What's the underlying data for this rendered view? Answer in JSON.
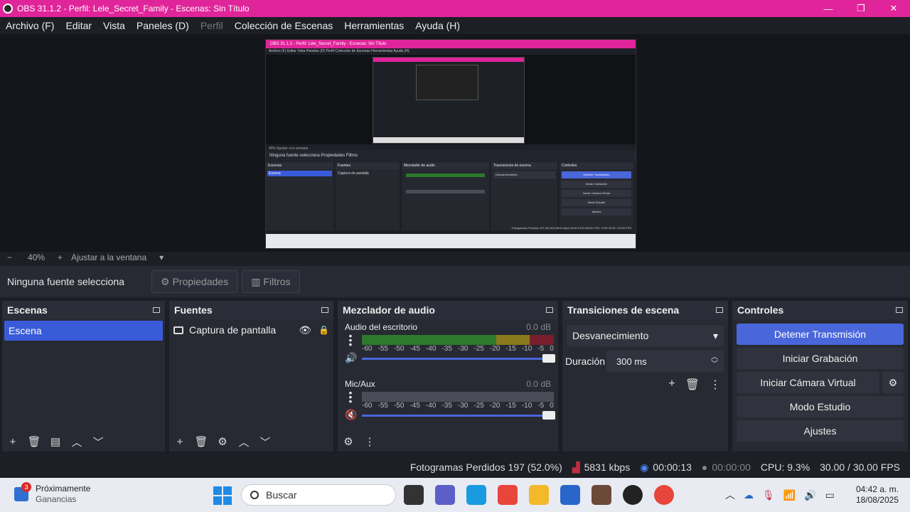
{
  "window": {
    "title": "OBS 31.1.2 - Perfil: Lele_Secret_Family - Escenas: Sin Título",
    "minimize": "—",
    "maximize": "❐",
    "close": "✕"
  },
  "menu": [
    "Archivo (F)",
    "Editar",
    "Vista",
    "Paneles (D)",
    "Perfil",
    "Colección de Escenas",
    "Herramientas",
    "Ayuda (H)"
  ],
  "mini": {
    "title": "OBS 31.1.2 - Perfil: Lele_Secret_Family - Escenas: Sin Título",
    "menu": "Archivo (F)   Editar   Vista   Paneles (D)   Perfil   Colección de Escenas   Herramientas   Ayuda (H)",
    "zoom": "40%   Ajustar a la ventana",
    "nosrc": "Ninguna fuente selecciona     Propiedades     Filtros",
    "escenas": "Escenas",
    "escena": "Escena",
    "fuentes": "Fuentes",
    "captura": "Captura de pantalla",
    "mezclador": "Mezclador de audio",
    "transiciones": "Transiciones de escena",
    "controles": "Controles",
    "b1": "Detener Transmisión",
    "b2": "Iniciar Grabación",
    "b3": "Iniciar Cámara Virtual",
    "b4": "Modo Estudio",
    "b5": "Ajustes",
    "status": "Fotogramas Perdidos 197 (52.0%)   5831 kbps   00:00:13   00:00:00   CPU: 9.3%   30.00 / 30.00 FPS"
  },
  "zoom": {
    "minus": "−",
    "value": "40%",
    "plus": "+",
    "fit": "Ajustar a la ventana",
    "caret": "▾"
  },
  "source_bar": {
    "none_selected": "Ninguna fuente selecciona",
    "properties": "Propiedades",
    "filters": "Filtros"
  },
  "scenes": {
    "title": "Escenas",
    "items": [
      "Escena"
    ]
  },
  "sources": {
    "title": "Fuentes",
    "items": [
      "Captura de pantalla"
    ]
  },
  "mixer": {
    "title": "Mezclador de audio",
    "channels": [
      {
        "name": "Audio del escritorio",
        "db": "0.0 dB",
        "level": 1.0
      },
      {
        "name": "Mic/Aux",
        "db": "0.0 dB",
        "level": 1.0
      }
    ],
    "scale": [
      "-60",
      "-55",
      "-50",
      "-45",
      "-40",
      "-35",
      "-30",
      "-25",
      "-20",
      "-15",
      "-10",
      "-5",
      "0"
    ]
  },
  "transitions": {
    "title": "Transiciones de escena",
    "selected": "Desvanecimiento",
    "duration_label": "Duración",
    "duration_value": "300 ms"
  },
  "controls": {
    "title": "Controles",
    "stop_stream": "Detener Transmisión",
    "start_recording": "Iniciar Grabación",
    "start_vcam": "Iniciar Cámara Virtual",
    "studio_mode": "Modo Estudio",
    "settings": "Ajustes"
  },
  "status": {
    "dropped": "Fotogramas Perdidos 197 (52.0%)",
    "kbps": "5831 kbps",
    "stream_time": "00:00:13",
    "rec_time": "00:00:00",
    "cpu": "CPU: 9.3%",
    "fps": "30.00 / 30.00 FPS"
  },
  "taskbar": {
    "widget_badge": "3",
    "widget_title": "Próximamente",
    "widget_sub": "Ganancias",
    "search": "Buscar",
    "time": "04:42 a. m.",
    "date": "18/08/2025"
  },
  "colors": {
    "accent": "#e0249a",
    "primary_button": "#4a66db",
    "selection": "#3a5bd9"
  }
}
